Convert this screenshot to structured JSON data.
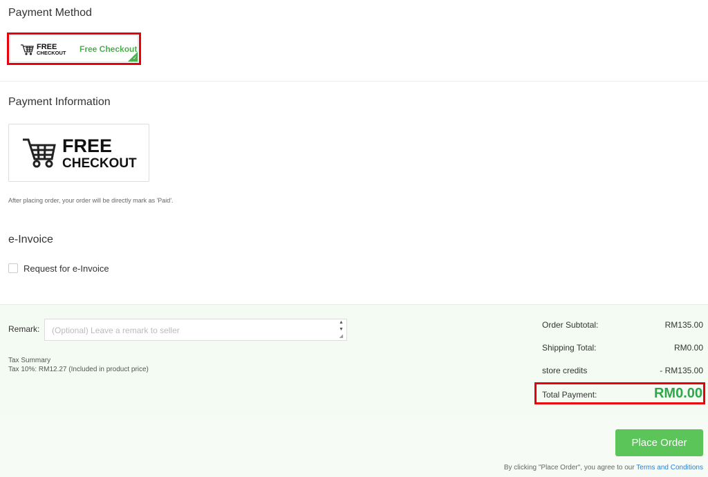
{
  "payment_method": {
    "title": "Payment Method",
    "option_label": "Free Checkout",
    "logo_line1": "FREE",
    "logo_line2": "CHECKOUT"
  },
  "payment_information": {
    "title": "Payment Information",
    "logo_line1": "FREE",
    "logo_line2": "CHECKOUT",
    "note": "After placing order, your order will be directly mark as 'Paid'."
  },
  "e_invoice": {
    "title": "e-Invoice",
    "checkbox_label": "Request for e-Invoice"
  },
  "remark": {
    "label": "Remark:",
    "placeholder": "(Optional) Leave a remark to seller"
  },
  "tax": {
    "title": "Tax Summary",
    "line": "Tax 10%: RM12.27  (Included in product price)"
  },
  "summary": {
    "subtotal_label": "Order Subtotal:",
    "subtotal_value": "RM135.00",
    "shipping_label": "Shipping Total:",
    "shipping_value": "RM0.00",
    "credits_label": "store credits",
    "credits_value": "- RM135.00",
    "total_label": "Total Payment:",
    "total_value": "RM0.00"
  },
  "footer": {
    "place_order": "Place Order",
    "agree_text": "By clicking \"Place Order\", you agree to our ",
    "terms_link": "Terms and Conditions"
  },
  "colors": {
    "accent_green": "#5cc55a",
    "total_green": "#2ea84a",
    "highlight_red": "#e8000b",
    "link_blue": "#2a7fd4"
  }
}
